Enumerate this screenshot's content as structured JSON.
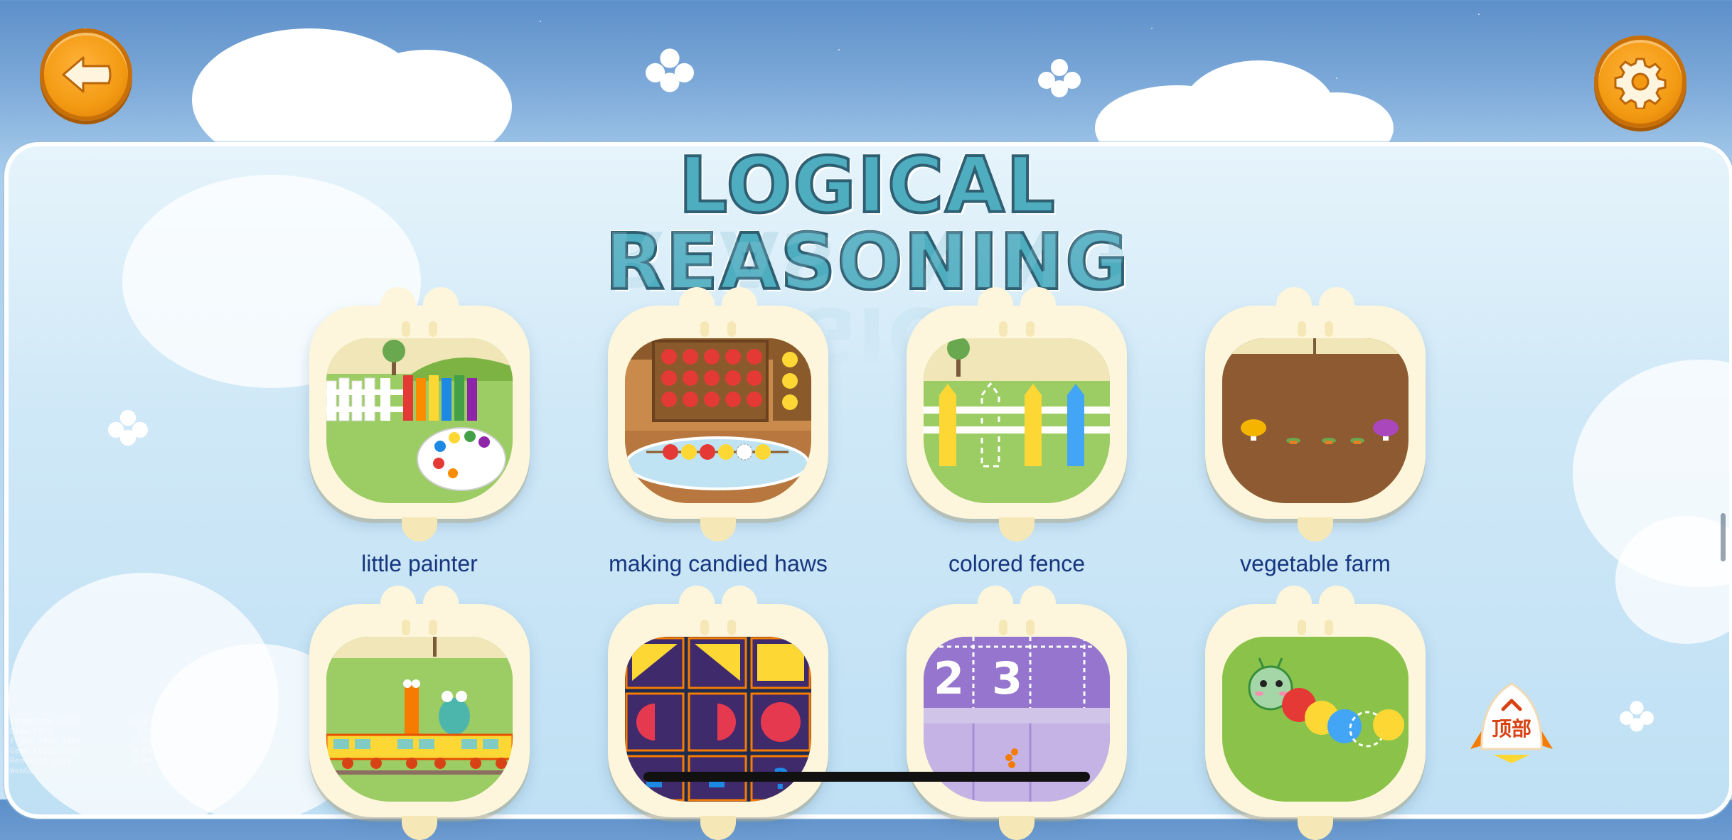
{
  "header": {
    "back_button": {
      "icon": "back-arrow-icon"
    },
    "settings_button": {
      "icon": "gear-icon"
    }
  },
  "page": {
    "title": "LOGICAL REASONING"
  },
  "games": [
    {
      "label": "little painter",
      "icon": "painter-scene"
    },
    {
      "label": "making candied haws",
      "icon": "candied-haws-scene"
    },
    {
      "label": "colored fence",
      "icon": "colored-fence-scene"
    },
    {
      "label": "vegetable farm",
      "icon": "vegetable-farm-scene"
    },
    {
      "label": "",
      "icon": "train-animals-scene"
    },
    {
      "label": "",
      "icon": "shapes-grid-scene"
    },
    {
      "label": "",
      "icon": "number-sequence-scene",
      "numbers": [
        "2",
        "3"
      ]
    },
    {
      "label": "",
      "icon": "caterpillar-scene"
    }
  ],
  "top_button": {
    "label": "顶部",
    "icon": "chevron-up-icon"
  },
  "debug_overlay": {
    "rows": [
      [
        "Framerate (FPS)",
        "59.97"
      ],
      [
        "Draw Call",
        "230"
      ],
      [
        "Frame time (ms)",
        "5.00"
      ],
      [
        "Game Logic (ms)",
        "0.04"
      ],
      [
        "Renderer (ms)",
        "0.04"
      ],
      [
        "WebGL",
        "1"
      ]
    ]
  },
  "colors": {
    "accent_orange": "#f39a12",
    "title_teal": "#4eaec0",
    "label_blue": "#16367f",
    "card_cream": "#fdf6dc"
  }
}
